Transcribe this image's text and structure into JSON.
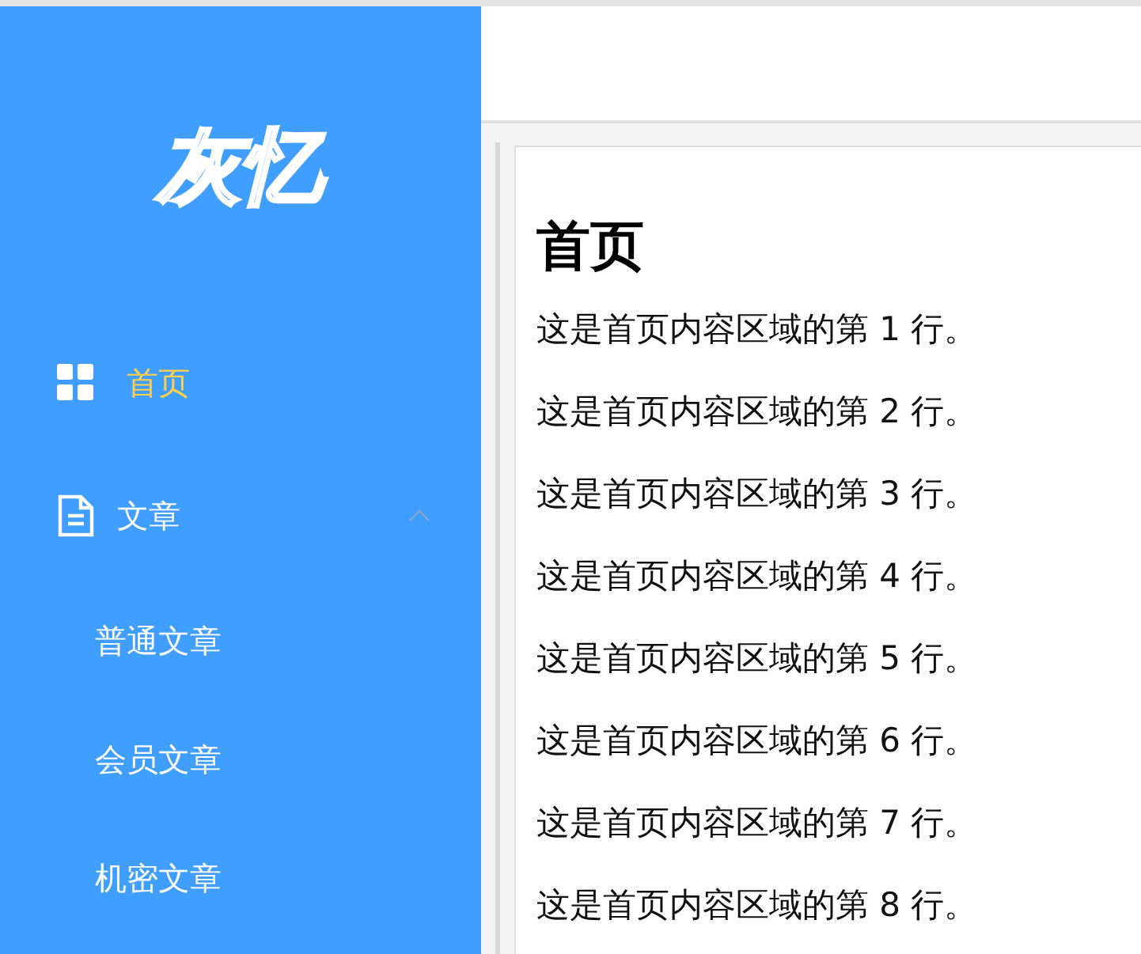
{
  "logo": {
    "text": "灰忆"
  },
  "sidebar": {
    "items": [
      {
        "kind": "item",
        "label": "首页",
        "selected": true
      },
      {
        "kind": "group",
        "label": "文章",
        "expanded": true,
        "selected": false,
        "children": [
          {
            "label": "普通文章",
            "selected": false
          },
          {
            "label": "会员文章",
            "selected": false
          },
          {
            "label": "机密文章",
            "selected": false
          }
        ]
      }
    ]
  },
  "content": {
    "heading": "首页",
    "lines": [
      "这是首页内容区域的第 1 行。",
      "这是首页内容区域的第 2 行。",
      "这是首页内容区域的第 3 行。",
      "这是首页内容区域的第 4 行。",
      "这是首页内容区域的第 5 行。",
      "这是首页内容区域的第 6 行。",
      "这是首页内容区域的第 7 行。",
      "这是首页内容区域的第 8 行。"
    ]
  }
}
